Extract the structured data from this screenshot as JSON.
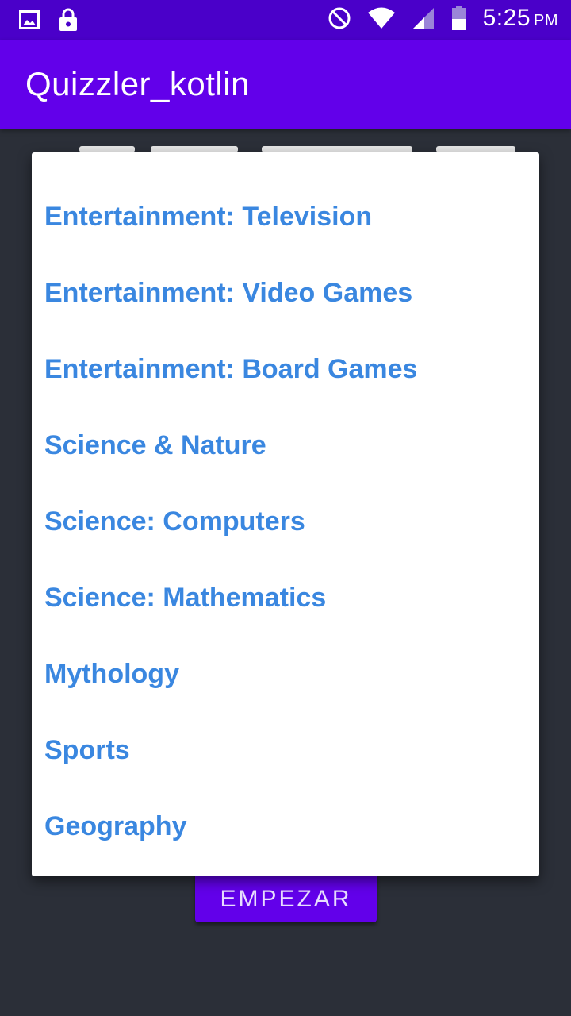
{
  "status_bar": {
    "time": "5:25",
    "meridiem": "PM",
    "icons": [
      "image-icon",
      "lock-icon",
      "do-not-disturb-icon",
      "wifi-icon",
      "signal-icon",
      "battery-icon"
    ]
  },
  "app_bar": {
    "title": "Quizzler_kotlin"
  },
  "dropdown": {
    "items": [
      "Entertainment: Television",
      "Entertainment: Video Games",
      "Entertainment: Board Games",
      "Science & Nature",
      "Science: Computers",
      "Science: Mathematics",
      "Mythology",
      "Sports",
      "Geography"
    ]
  },
  "start_button": {
    "label": "EMPEZAR"
  },
  "colors": {
    "status_bar": "#4a00c9",
    "app_bar": "#6200ea",
    "background": "#2b2f38",
    "item_text": "#3a87e0"
  }
}
